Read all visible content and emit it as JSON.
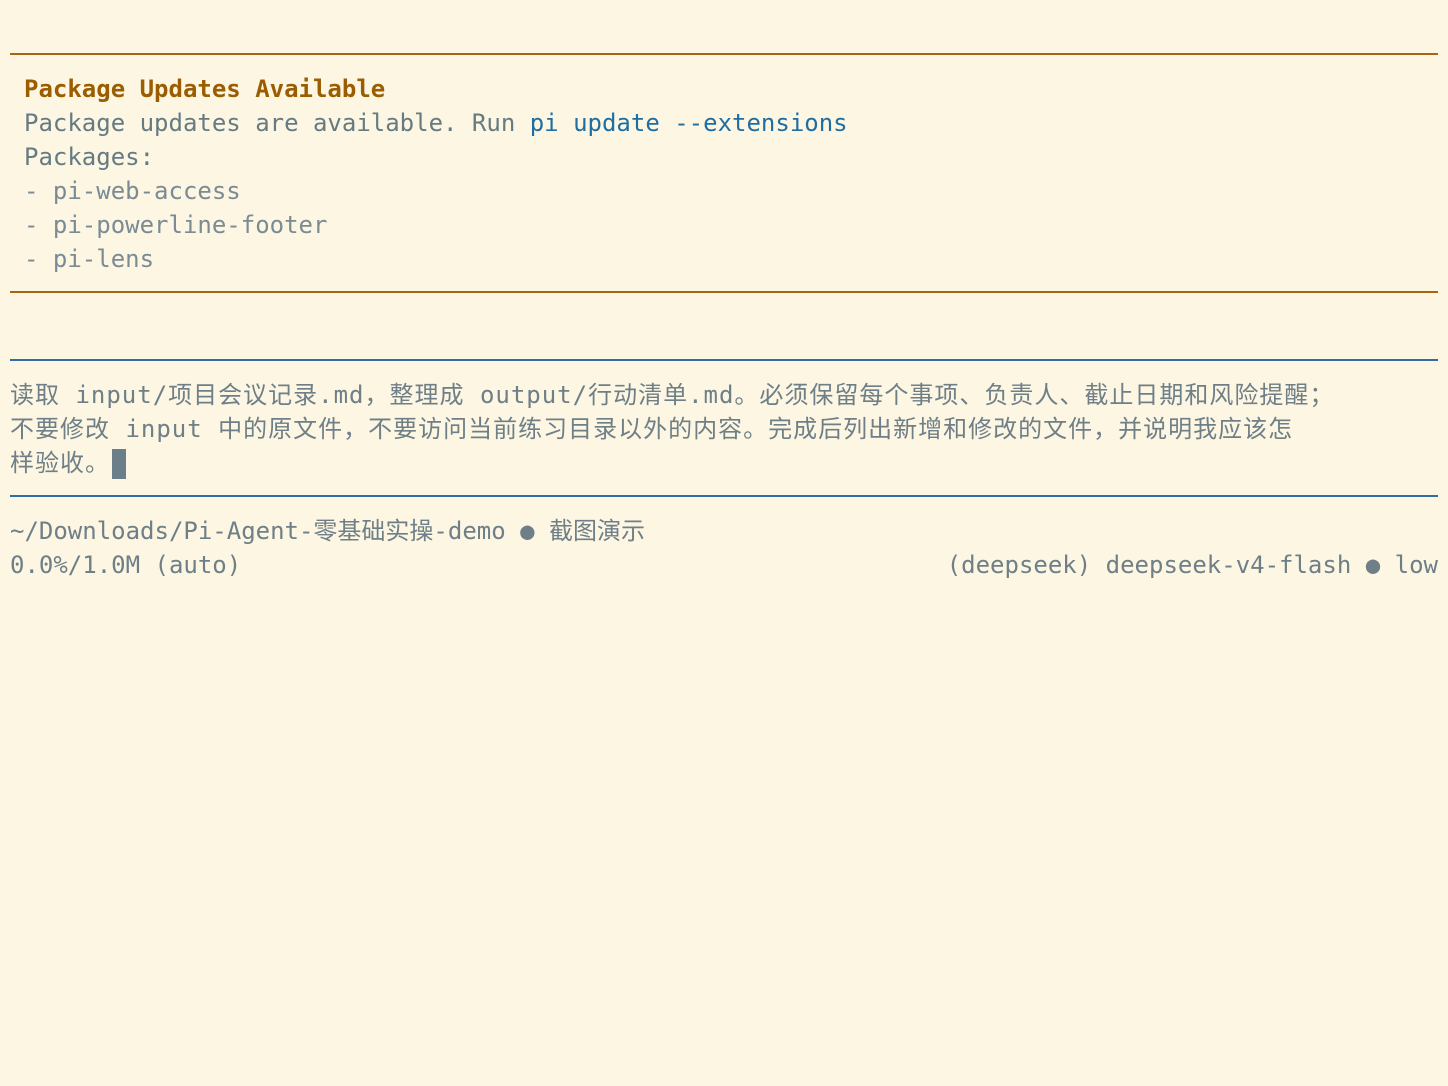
{
  "notice": {
    "title": "Package Updates Available",
    "message_prefix": "Package updates are available. Run ",
    "command": "pi update --extensions",
    "packages_label": "Packages:",
    "packages": [
      "- pi-web-access",
      "- pi-powerline-footer",
      "- pi-lens"
    ]
  },
  "prompt": {
    "lines": [
      "读取 input/项目会议记录.md，整理成 output/行动清单.md。必须保留每个事项、负责人、截止日期和风险提醒；",
      "不要修改 input 中的原文件，不要访问当前练习目录以外的内容。完成后列出新增和修改的文件，并说明我应该怎",
      "样验收。"
    ]
  },
  "status": {
    "path": "~/Downloads/Pi-Agent-零基础实操-demo",
    "separator": "●",
    "session_name": "截图演示",
    "context_usage": "0.0%/1.0M (auto)",
    "provider_model": "(deepseek) deepseek-v4-flash",
    "thinking_level": "low"
  },
  "colors": {
    "background": "#fdf6e3",
    "amber_rule": "#a8650f",
    "blue_rule": "#2f6ea5",
    "title": "#9a5d00",
    "command": "#1f6ea3",
    "text": "#657b83"
  }
}
